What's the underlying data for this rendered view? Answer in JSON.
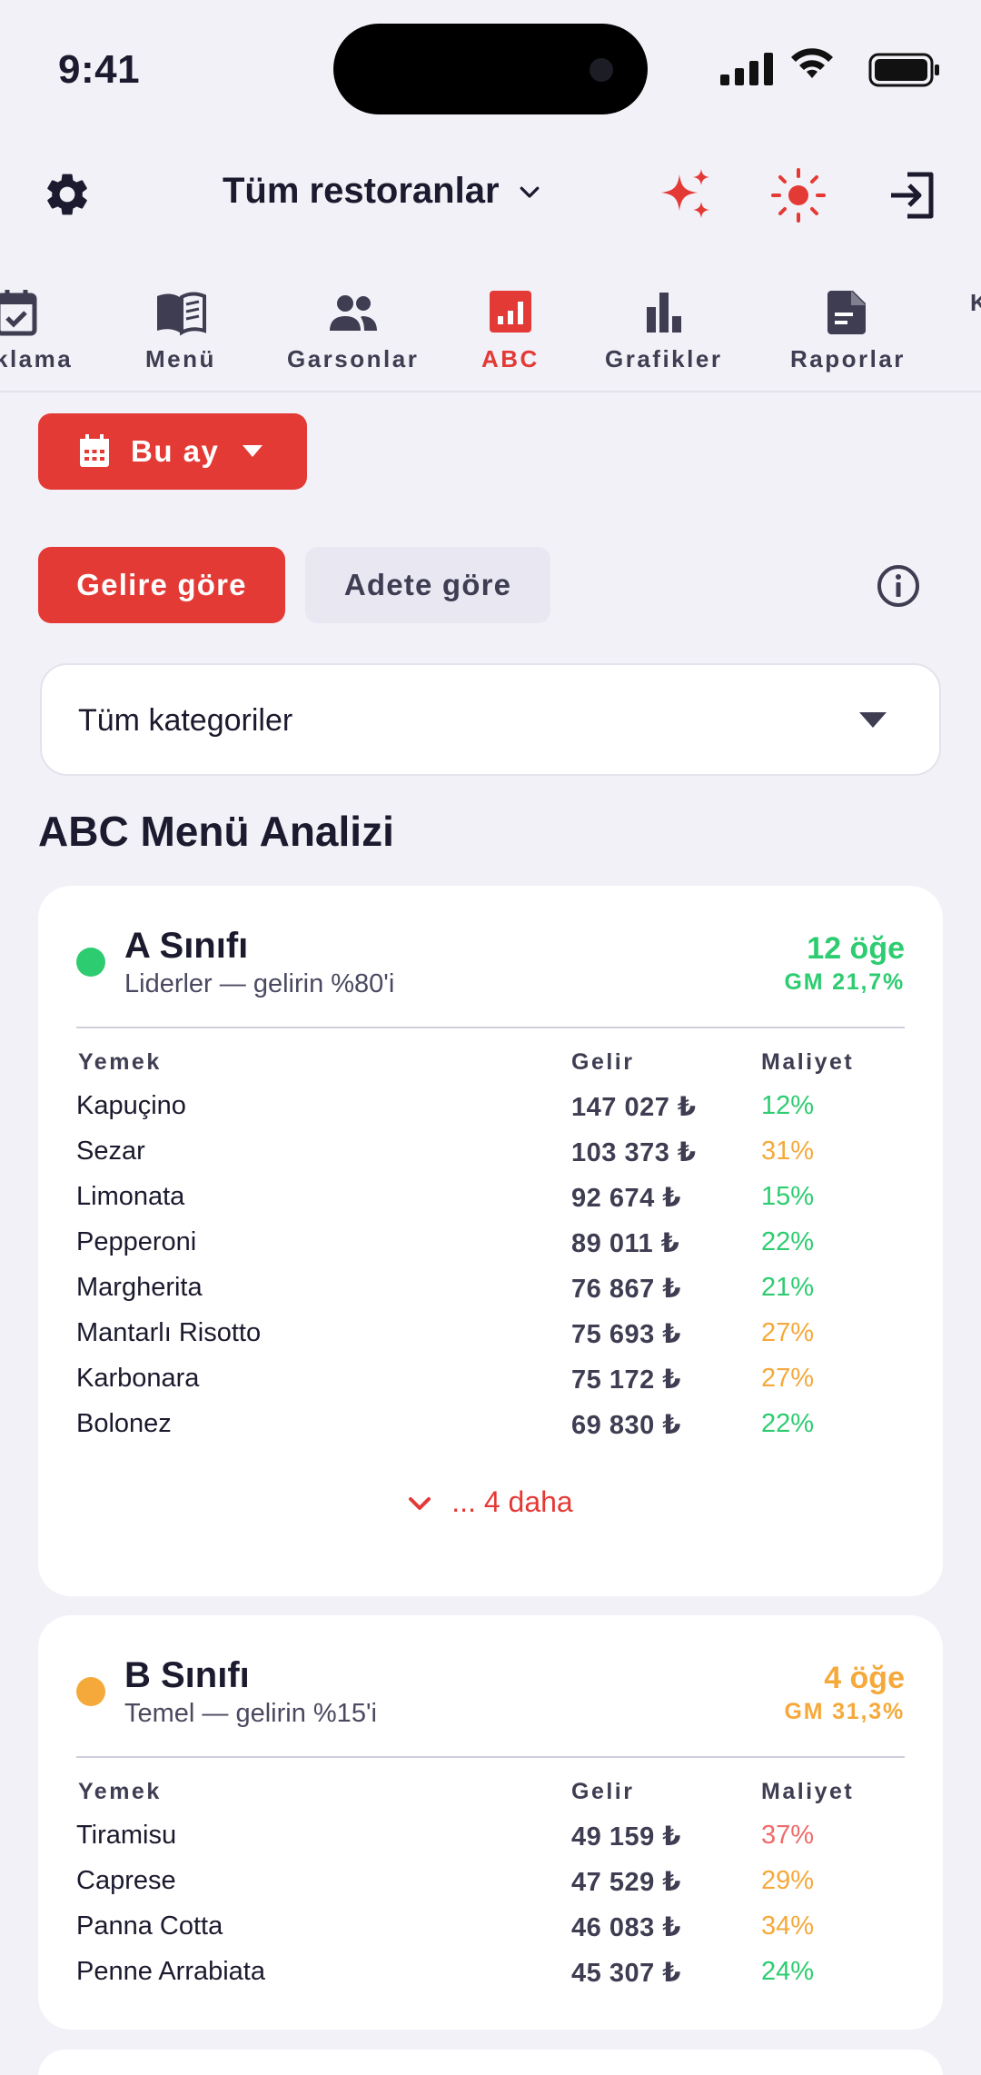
{
  "status": {
    "time": "9:41"
  },
  "header": {
    "restaurant": "Tüm restoranlar"
  },
  "tabs": [
    {
      "label": "klama",
      "icon": "calendar-check-icon",
      "active": false
    },
    {
      "label": "Menü",
      "icon": "book-icon",
      "active": false
    },
    {
      "label": "Garsonlar",
      "icon": "people-icon",
      "active": false
    },
    {
      "label": "ABC",
      "icon": "analytics-icon",
      "active": true
    },
    {
      "label": "Grafikler",
      "icon": "bar-chart-icon",
      "active": false
    },
    {
      "label": "Raporlar",
      "icon": "document-icon",
      "active": false
    }
  ],
  "period": {
    "label": "Bu ay"
  },
  "mode": {
    "active": "Gelire göre",
    "other": "Adete göre"
  },
  "category": {
    "value": "Tüm kategoriler"
  },
  "section_title": "ABC Menü Analizi",
  "columns": {
    "dish": "Yemek",
    "revenue": "Gelir",
    "cost": "Maliyet"
  },
  "colors": {
    "accent": "#e43a36",
    "green": "#2ecc71",
    "orange": "#f5a93b",
    "red": "#ef6b6b"
  },
  "class_a": {
    "name": "A Sınıfı",
    "subtitle": "Liderler — gelirin %80'i",
    "count": "12 öğe",
    "gm": "GM 21,7%",
    "rows": [
      {
        "dish": "Kapuçino",
        "revenue": "147 027 ₺",
        "cost": "12%"
      },
      {
        "dish": "Sezar",
        "revenue": "103 373 ₺",
        "cost": "31%"
      },
      {
        "dish": "Limonata",
        "revenue": "92 674 ₺",
        "cost": "15%"
      },
      {
        "dish": "Pepperoni",
        "revenue": "89 011 ₺",
        "cost": "22%"
      },
      {
        "dish": "Margherita",
        "revenue": "76 867 ₺",
        "cost": "21%"
      },
      {
        "dish": "Mantarlı Risotto",
        "revenue": "75 693 ₺",
        "cost": "27%"
      },
      {
        "dish": "Karbonara",
        "revenue": "75 172 ₺",
        "cost": "27%"
      },
      {
        "dish": "Bolonez",
        "revenue": "69 830 ₺",
        "cost": "22%"
      }
    ],
    "more": "... 4 daha"
  },
  "class_b": {
    "name": "B Sınıfı",
    "subtitle": "Temel — gelirin %15'i",
    "count": "4 öğe",
    "gm": "GM 31,3%",
    "rows": [
      {
        "dish": "Tiramisu",
        "revenue": "49 159 ₺",
        "cost": "37%"
      },
      {
        "dish": "Caprese",
        "revenue": "47 529 ₺",
        "cost": "29%"
      },
      {
        "dish": "Panna Cotta",
        "revenue": "46 083 ₺",
        "cost": "34%"
      },
      {
        "dish": "Penne Arrabiata",
        "revenue": "45 307 ₺",
        "cost": "24%"
      }
    ]
  }
}
